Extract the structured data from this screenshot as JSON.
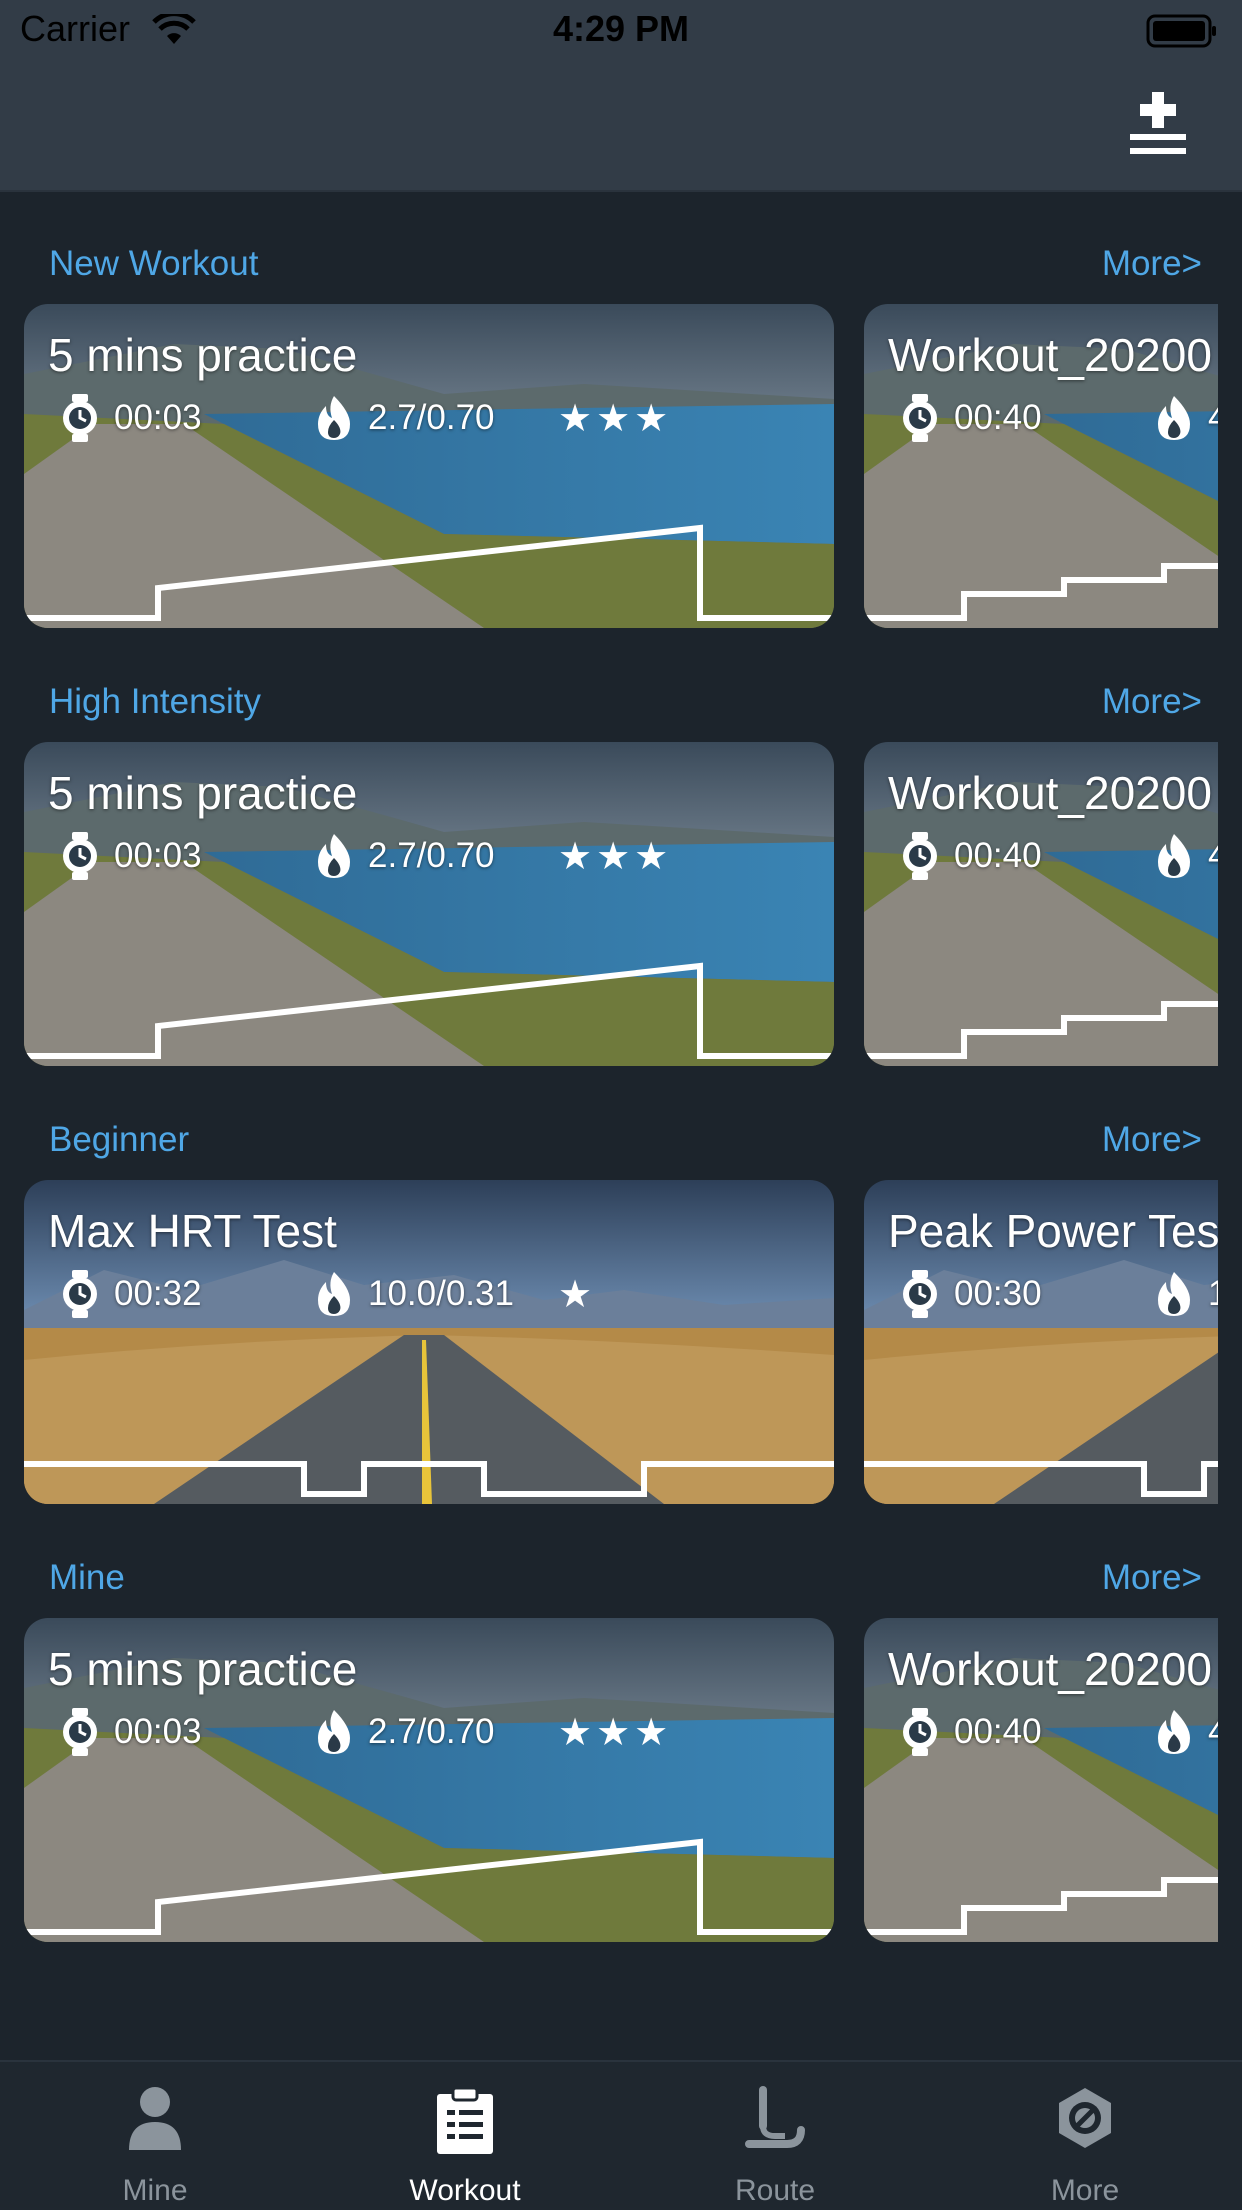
{
  "status": {
    "carrier": "Carrier",
    "time": "4:29 PM"
  },
  "colors": {
    "accent": "#4fa7e6",
    "background": "#1c242c",
    "bar": "#323c47"
  },
  "header": {
    "add_icon": "add-list-icon"
  },
  "sections": [
    {
      "title": "New Workout",
      "more": "More>",
      "cards": [
        {
          "title": "5 mins practice",
          "duration": "00:03",
          "calories": "2.7/0.70",
          "rating": "★★★",
          "scene": "lake-road"
        },
        {
          "title": "Workout_20200",
          "duration": "00:40",
          "calories": "4",
          "scene": "lake-road"
        }
      ]
    },
    {
      "title": "High Intensity",
      "more": "More>",
      "cards": [
        {
          "title": "5 mins practice",
          "duration": "00:03",
          "calories": "2.7/0.70",
          "rating": "★★★",
          "scene": "lake-road"
        },
        {
          "title": "Workout_20200",
          "duration": "00:40",
          "calories": "4",
          "scene": "lake-road"
        }
      ]
    },
    {
      "title": "Beginner",
      "more": "More>",
      "cards": [
        {
          "title": "Max HRT Test",
          "duration": "00:32",
          "calories": "10.0/0.31",
          "rating": "★",
          "scene": "desert-road"
        },
        {
          "title": "Peak Power Tes",
          "duration": "00:30",
          "calories": "1",
          "scene": "desert-road"
        }
      ]
    },
    {
      "title": "Mine",
      "more": "More>",
      "cards": [
        {
          "title": "5 mins practice",
          "duration": "00:03",
          "calories": "2.7/0.70",
          "rating": "★★★",
          "scene": "lake-road"
        },
        {
          "title": "Workout_20200",
          "duration": "00:40",
          "calories": "4",
          "scene": "lake-road"
        }
      ]
    }
  ],
  "tabs": [
    {
      "label": "Mine",
      "icon": "person-icon"
    },
    {
      "label": "Workout",
      "icon": "clipboard-icon",
      "active": true
    },
    {
      "label": "Route",
      "icon": "route-icon"
    },
    {
      "label": "More",
      "icon": "settings-icon"
    }
  ]
}
